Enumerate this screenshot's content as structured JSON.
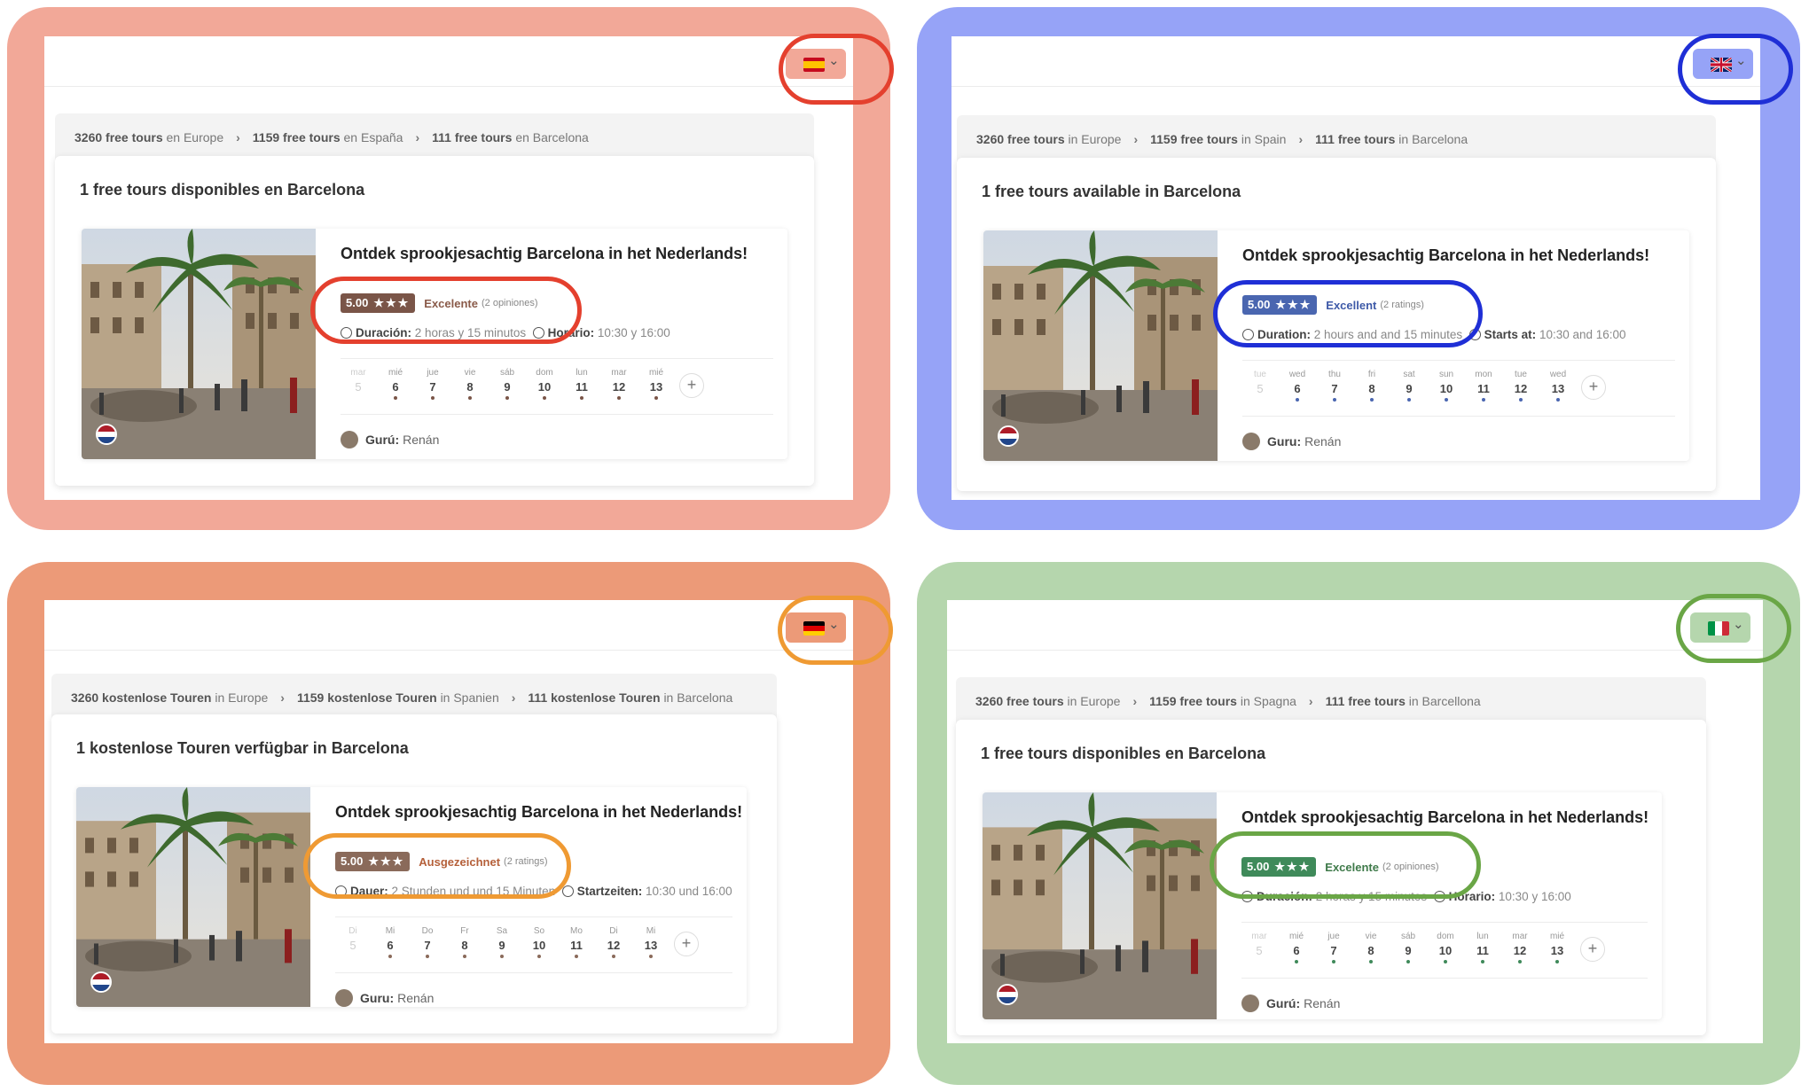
{
  "panels": [
    {
      "lang": "es",
      "flag_icon": "spain-flag-icon",
      "highlight_color": "#e4402e",
      "panel_color": "#f2a898",
      "score_bg": "#7a5548",
      "label_color": "#8a5b4a",
      "breadcrumb": [
        {
          "count": "3260 free tours",
          "place": "en Europe"
        },
        {
          "count": "1159 free tours",
          "place": "en España"
        },
        {
          "count": "111 free tours",
          "place": "en Barcelona"
        }
      ],
      "availability": "1 free tours disponibles en Barcelona",
      "tour": {
        "title": "Ontdek sprookjesachtig Barcelona in het Nederlands!",
        "score": "5.00",
        "rating_label": "Excelente",
        "rating_count": "(2 opiniones)",
        "duration_label": "Duración:",
        "duration_value": "2 horas y 15 minutos",
        "schedule_label": "Horario:",
        "schedule_value": "10:30 y 16:00",
        "days": [
          {
            "name": "mar",
            "num": "5"
          },
          {
            "name": "mié",
            "num": "6"
          },
          {
            "name": "jue",
            "num": "7"
          },
          {
            "name": "vie",
            "num": "8"
          },
          {
            "name": "sáb",
            "num": "9"
          },
          {
            "name": "dom",
            "num": "10"
          },
          {
            "name": "lun",
            "num": "11"
          },
          {
            "name": "mar",
            "num": "12"
          },
          {
            "name": "mié",
            "num": "13"
          }
        ],
        "plus": "+",
        "guru_label": "Gurú:",
        "guru_name": "Renán"
      }
    },
    {
      "lang": "en",
      "flag_icon": "uk-flag-icon",
      "highlight_color": "#1f2fd6",
      "panel_color": "#96a3f7",
      "score_bg": "#4a66b0",
      "label_color": "#3e5aa8",
      "breadcrumb": [
        {
          "count": "3260 free tours",
          "place": "in Europe"
        },
        {
          "count": "1159 free tours",
          "place": "in Spain"
        },
        {
          "count": "111 free tours",
          "place": "in Barcelona"
        }
      ],
      "availability": "1 free tours available in Barcelona",
      "tour": {
        "title": "Ontdek sprookjesachtig Barcelona in het Nederlands!",
        "score": "5.00",
        "rating_label": "Excellent",
        "rating_count": "(2 ratings)",
        "duration_label": "Duration:",
        "duration_value": "2 hours and and 15 minutes",
        "schedule_label": "Starts at:",
        "schedule_value": "10:30 and 16:00",
        "days": [
          {
            "name": "tue",
            "num": "5"
          },
          {
            "name": "wed",
            "num": "6"
          },
          {
            "name": "thu",
            "num": "7"
          },
          {
            "name": "fri",
            "num": "8"
          },
          {
            "name": "sat",
            "num": "9"
          },
          {
            "name": "sun",
            "num": "10"
          },
          {
            "name": "mon",
            "num": "11"
          },
          {
            "name": "tue",
            "num": "12"
          },
          {
            "name": "wed",
            "num": "13"
          }
        ],
        "plus": "+",
        "guru_label": "Guru:",
        "guru_name": "Renán"
      }
    },
    {
      "lang": "de",
      "flag_icon": "germany-flag-icon",
      "highlight_color": "#ef9a33",
      "panel_color": "#ec9a78",
      "score_bg": "#8a6a5a",
      "label_color": "#b5603a",
      "breadcrumb": [
        {
          "count": "3260 kostenlose Touren",
          "place": "in Europe"
        },
        {
          "count": "1159 kostenlose Touren",
          "place": "in Spanien"
        },
        {
          "count": "111 kostenlose Touren",
          "place": "in Barcelona"
        }
      ],
      "availability": "1 kostenlose Touren verfügbar in Barcelona",
      "tour": {
        "title": "Ontdek sprookjesachtig Barcelona in het Nederlands!",
        "score": "5.00",
        "rating_label": "Ausgezeichnet",
        "rating_count": "(2 ratings)",
        "duration_label": "Dauer:",
        "duration_value": "2 Stunden und und 15 Minuten",
        "schedule_label": "Startzeiten:",
        "schedule_value": "10:30 und 16:00",
        "days": [
          {
            "name": "Di",
            "num": "5"
          },
          {
            "name": "Mi",
            "num": "6"
          },
          {
            "name": "Do",
            "num": "7"
          },
          {
            "name": "Fr",
            "num": "8"
          },
          {
            "name": "Sa",
            "num": "9"
          },
          {
            "name": "So",
            "num": "10"
          },
          {
            "name": "Mo",
            "num": "11"
          },
          {
            "name": "Di",
            "num": "12"
          },
          {
            "name": "Mi",
            "num": "13"
          }
        ],
        "plus": "+",
        "guru_label": "Guru:",
        "guru_name": "Renán"
      }
    },
    {
      "lang": "it",
      "flag_icon": "italy-flag-icon",
      "highlight_color": "#6aa646",
      "panel_color": "#b5d6ad",
      "score_bg": "#3f8a5a",
      "label_color": "#3f7a4a",
      "breadcrumb": [
        {
          "count": "3260 free tours",
          "place": "in Europe"
        },
        {
          "count": "1159 free tours",
          "place": "in Spagna"
        },
        {
          "count": "111 free tours",
          "place": "in Barcellona"
        }
      ],
      "availability": "1 free tours disponibles en Barcelona",
      "tour": {
        "title": "Ontdek sprookjesachtig Barcelona in het Nederlands!",
        "score": "5.00",
        "rating_label": "Excelente",
        "rating_count": "(2 opiniones)",
        "duration_label": "Duración:",
        "duration_value": "2 horas y 15 minutos",
        "schedule_label": "Horario:",
        "schedule_value": "10:30 y 16:00",
        "days": [
          {
            "name": "mar",
            "num": "5"
          },
          {
            "name": "mié",
            "num": "6"
          },
          {
            "name": "jue",
            "num": "7"
          },
          {
            "name": "vie",
            "num": "8"
          },
          {
            "name": "sáb",
            "num": "9"
          },
          {
            "name": "dom",
            "num": "10"
          },
          {
            "name": "lun",
            "num": "11"
          },
          {
            "name": "mar",
            "num": "12"
          },
          {
            "name": "mié",
            "num": "13"
          }
        ],
        "plus": "+",
        "guru_label": "Gurú:",
        "guru_name": "Renán"
      }
    }
  ],
  "stars": "★★★",
  "crumb_separator": "›"
}
